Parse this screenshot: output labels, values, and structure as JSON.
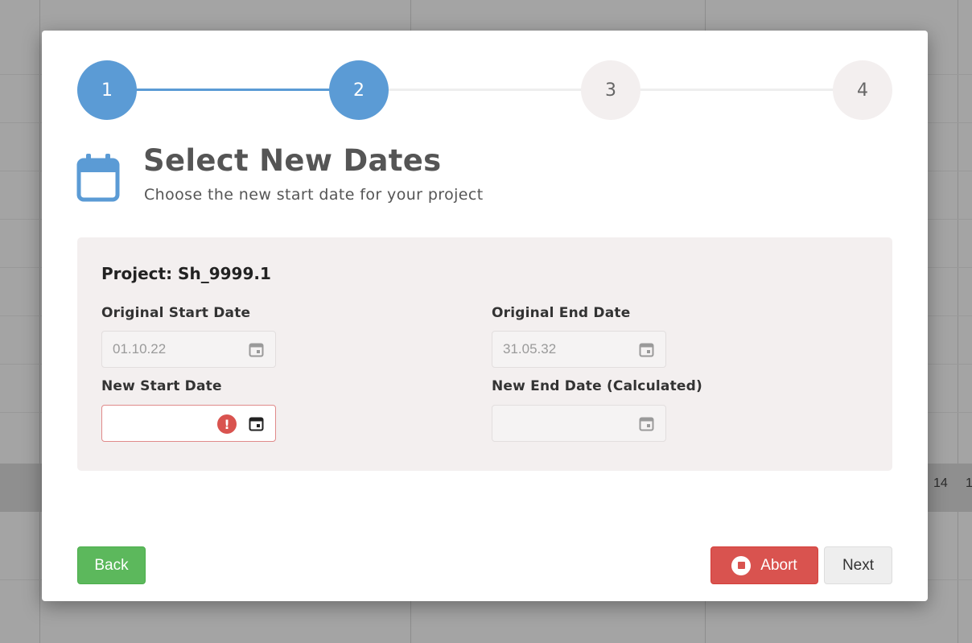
{
  "background": {
    "cell_texts": [
      "14",
      "1"
    ]
  },
  "stepper": {
    "steps": [
      {
        "label": "1",
        "state": "complete"
      },
      {
        "label": "2",
        "state": "active"
      },
      {
        "label": "3",
        "state": "inactive"
      },
      {
        "label": "4",
        "state": "inactive"
      }
    ],
    "colors": {
      "active": "#5b9bd5",
      "inactive": "#f3efef"
    }
  },
  "header": {
    "icon": "calendar-icon",
    "title": "Select New Dates",
    "subtitle": "Choose the new start date for your project"
  },
  "project": {
    "label": "Project: Sh_9999.1",
    "original_start": {
      "label": "Original Start Date",
      "value": "01.10.22",
      "icon": "calendar-icon"
    },
    "original_end": {
      "label": "Original End Date",
      "value": "31.05.32",
      "icon": "calendar-icon"
    },
    "new_start": {
      "label": "New Start Date",
      "value": "",
      "state": "error",
      "icons": [
        "error-icon",
        "calendar-icon"
      ]
    },
    "new_end": {
      "label": "New End Date (Calculated)",
      "value": "",
      "icon": "calendar-icon"
    }
  },
  "buttons": {
    "back": "Back",
    "abort": "Abort",
    "next": "Next"
  },
  "colors": {
    "accent": "#5b9bd5",
    "success": "#5cb85c",
    "danger": "#d9534f"
  }
}
